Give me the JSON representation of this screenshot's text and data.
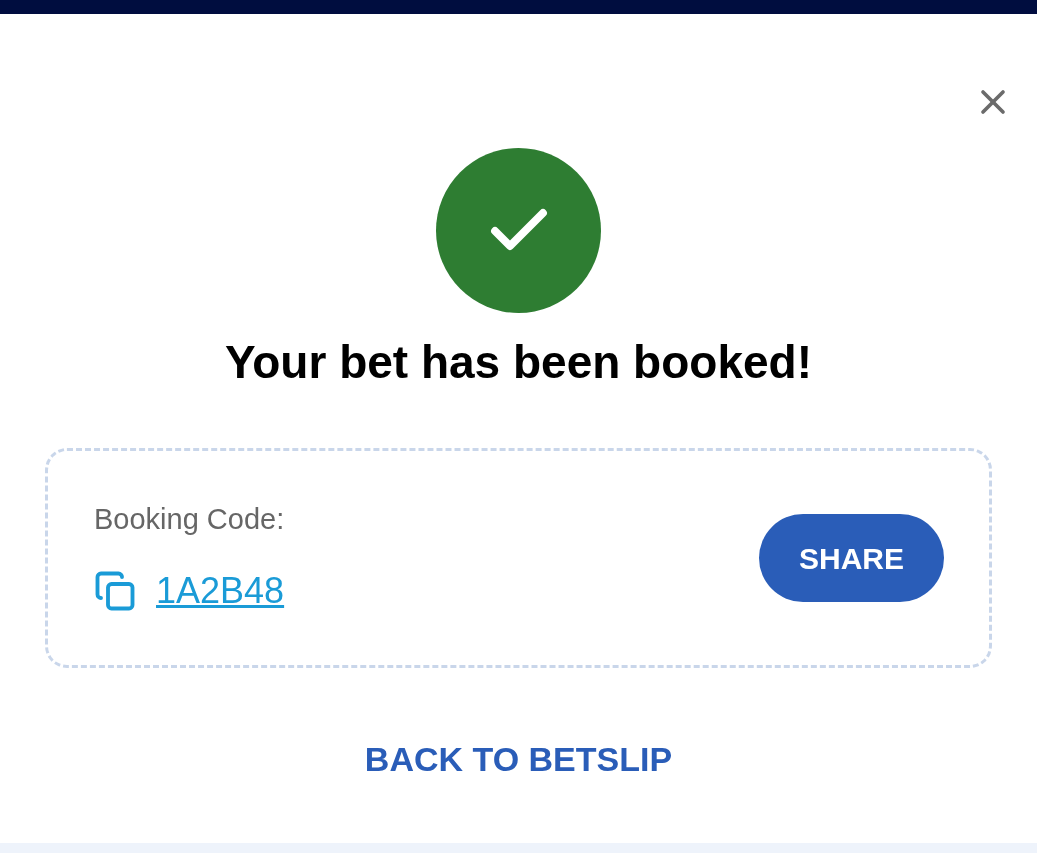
{
  "dialog": {
    "title": "Your bet has been booked!",
    "booking": {
      "label": "Booking Code:",
      "code": "1A2B48",
      "action": "SHARE"
    },
    "back_button": "BACK TO BETSLIP"
  }
}
